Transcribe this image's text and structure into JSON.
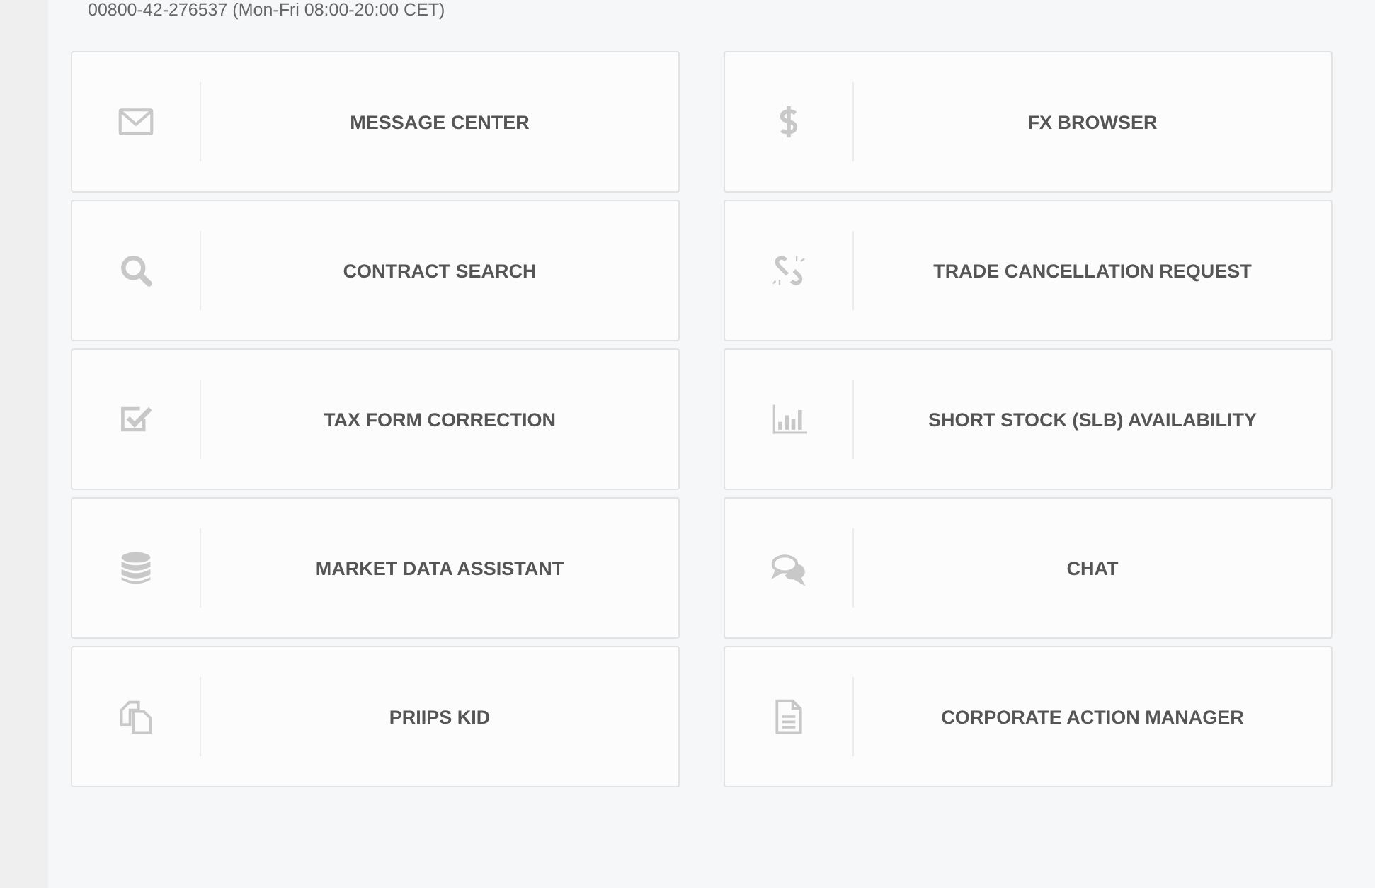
{
  "contact_line": "00800-42-276537 (Mon-Fri 08:00-20:00 CET)",
  "tiles": [
    {
      "label": "MESSAGE CENTER",
      "kind": "envelope"
    },
    {
      "label": "FX BROWSER",
      "kind": "dollar"
    },
    {
      "label": "CONTRACT SEARCH",
      "kind": "search"
    },
    {
      "label": "TRADE CANCELLATION REQUEST",
      "kind": "unlink"
    },
    {
      "label": "TAX FORM CORRECTION",
      "kind": "checkbox"
    },
    {
      "label": "SHORT STOCK (SLB) AVAILABILITY",
      "kind": "barchart"
    },
    {
      "label": "MARKET DATA ASSISTANT",
      "kind": "database"
    },
    {
      "label": "CHAT",
      "kind": "chat"
    },
    {
      "label": "PRIIPS KID",
      "kind": "copy"
    },
    {
      "label": "CORPORATE ACTION MANAGER",
      "kind": "document"
    }
  ]
}
